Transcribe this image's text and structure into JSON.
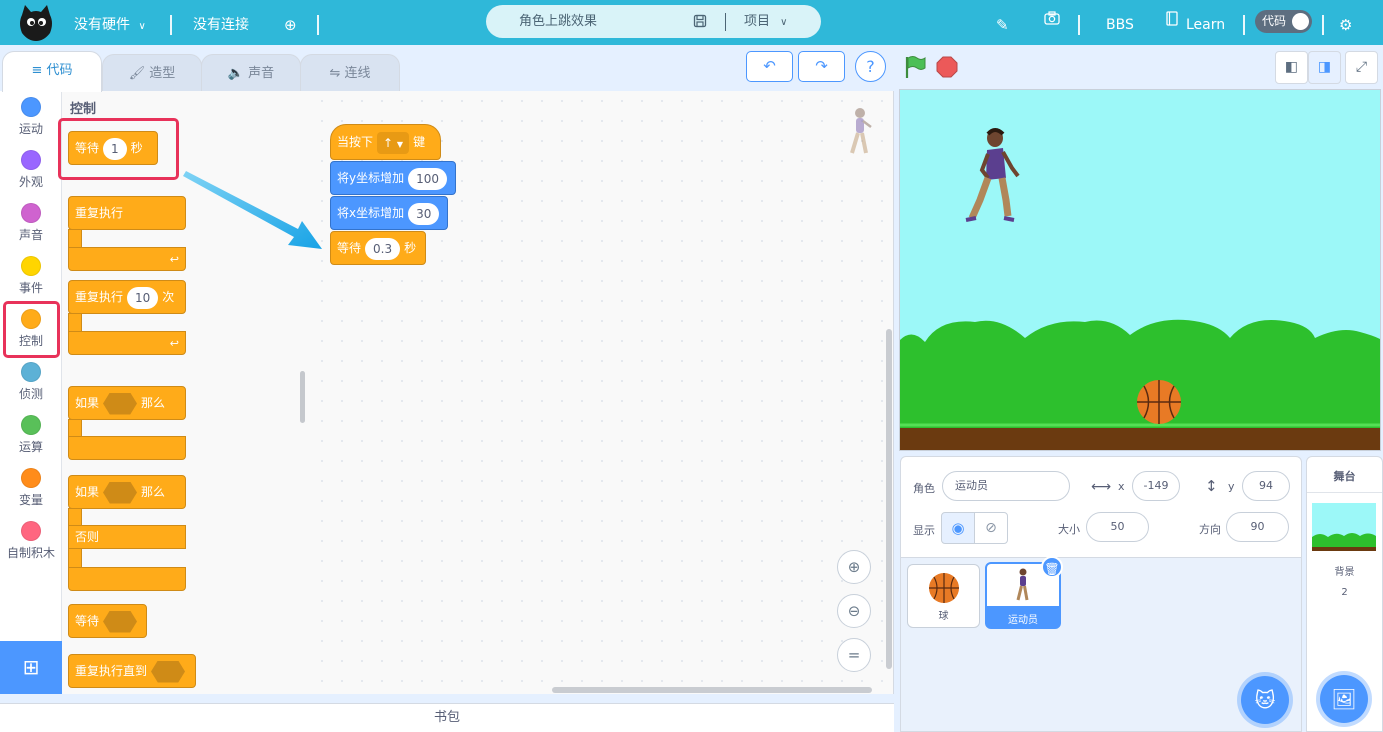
{
  "topbar": {
    "hardware": "没有硬件",
    "connection": "没有连接",
    "project_title": "角色上跳效果",
    "project_menu": "项目",
    "bbs": "BBS",
    "learn": "Learn",
    "code_toggle": "代码"
  },
  "tabs": {
    "code": "代码",
    "costume": "造型",
    "sound": "声音",
    "wiring": "连线"
  },
  "categories": [
    {
      "label": "运动",
      "color": "#4c97ff"
    },
    {
      "label": "外观",
      "color": "#9966ff"
    },
    {
      "label": "声音",
      "color": "#cf63cf"
    },
    {
      "label": "事件",
      "color": "#ffd500"
    },
    {
      "label": "控制",
      "color": "#ffab19"
    },
    {
      "label": "侦测",
      "color": "#5cb1d6"
    },
    {
      "label": "运算",
      "color": "#59c059"
    },
    {
      "label": "变量",
      "color": "#ff8c1a"
    },
    {
      "label": "自制积木",
      "color": "#ff6680"
    }
  ],
  "palette": {
    "title": "控制",
    "wait_label": "等待",
    "wait_value": "1",
    "wait_unit": "秒",
    "forever_label": "重复执行",
    "repeat_label": "重复执行",
    "repeat_value": "10",
    "repeat_unit": "次",
    "if_label": "如果",
    "then_label": "那么",
    "if2_label": "如果",
    "then2_label": "那么",
    "else_label": "否则",
    "wait_until_label": "等待",
    "repeat_until_label": "重复执行直到"
  },
  "script": {
    "hat_label": "当按下",
    "hat_key": "↑",
    "hat_suffix": "键",
    "change_y_label": "将y坐标增加",
    "change_y_value": "100",
    "change_x_label": "将x坐标增加",
    "change_x_value": "30",
    "wait_label": "等待",
    "wait_value": "0.3",
    "wait_unit": "秒"
  },
  "backpack": "书包",
  "sprite_info": {
    "sprite_label": "角色",
    "sprite_name": "运动员",
    "x_label": "x",
    "x_value": "-149",
    "y_label": "y",
    "y_value": "94",
    "show_label": "显示",
    "size_label": "大小",
    "size_value": "50",
    "direction_label": "方向",
    "direction_value": "90"
  },
  "sprites": [
    {
      "name": "球"
    },
    {
      "name": "运动员",
      "selected": true
    }
  ],
  "stage_panel": {
    "title": "舞台",
    "backdrop_label": "背景",
    "backdrop_count": "2"
  },
  "colors": {
    "topbar": "#2fb8d9",
    "accent": "#4c97ff",
    "control": "#ffab19",
    "highlight": "#e8325a"
  }
}
